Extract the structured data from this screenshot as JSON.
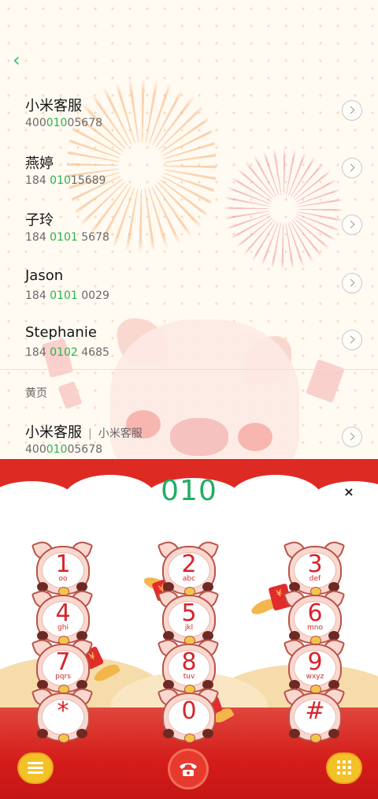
{
  "contacts": [
    {
      "name": "小米客服",
      "number_pre": "400",
      "number_hl": "010",
      "number_post": "05678"
    },
    {
      "name": "燕婷",
      "number_pre": "184 ",
      "number_hl": "010",
      "number_post": "15689"
    },
    {
      "name": "子玲",
      "number_pre": "184 ",
      "number_hl": "0101",
      "number_post": " 5678"
    },
    {
      "name": "Jason",
      "number_pre": "184 ",
      "number_hl": "0101",
      "number_post": " 0029"
    },
    {
      "name": "Stephanie",
      "number_pre": "184 ",
      "number_hl": "0102",
      "number_post": " 4685"
    }
  ],
  "yellow_pages": {
    "section_label": "黄页",
    "entry": {
      "name": "小米客服",
      "separator": "|",
      "subtitle": "小米客服",
      "number_pre": "400",
      "number_hl": "010",
      "number_post": "05678"
    }
  },
  "dialer": {
    "digits": "010",
    "clear_glyph": "×",
    "keys": [
      {
        "digit": "1",
        "letters": "oo"
      },
      {
        "digit": "2",
        "letters": "abc"
      },
      {
        "digit": "3",
        "letters": "def"
      },
      {
        "digit": "4",
        "letters": "ghi"
      },
      {
        "digit": "5",
        "letters": "jkl"
      },
      {
        "digit": "6",
        "letters": "mno"
      },
      {
        "digit": "7",
        "letters": "pqrs"
      },
      {
        "digit": "8",
        "letters": "tuv"
      },
      {
        "digit": "9",
        "letters": "wxyz"
      },
      {
        "digit": "*",
        "letters": ""
      },
      {
        "digit": "0",
        "letters": ""
      },
      {
        "digit": "#",
        "letters": ""
      }
    ]
  },
  "icons": {
    "back": "back-arrow-icon",
    "chevron": "chevron-right-icon",
    "menu": "menu-icon",
    "call": "phone-handset-icon",
    "keypad": "keypad-grid-icon"
  },
  "colors": {
    "highlight": "#2bb34b",
    "dialed_digits": "#1fae66",
    "theme_red": "#dd2a23",
    "call_button": "#e73a2f"
  }
}
